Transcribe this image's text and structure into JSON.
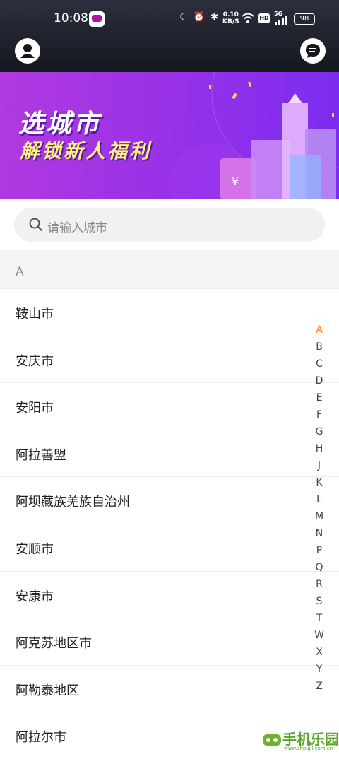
{
  "status_bar": {
    "time": "10:08",
    "speed_value": "0.10",
    "speed_unit": "KB/S",
    "hd": "HD",
    "network": "5G",
    "battery": "98"
  },
  "banner": {
    "title": "选城市",
    "subtitle": "解锁新人福利"
  },
  "search": {
    "placeholder": "请输入城市"
  },
  "section": {
    "letter": "A"
  },
  "cities": [
    "鞍山市",
    "安庆市",
    "安阳市",
    "阿拉善盟",
    "阿坝藏族羌族自治州",
    "安顺市",
    "安康市",
    "阿克苏地区市",
    "阿勒泰地区",
    "阿拉尔市"
  ],
  "index_letters": [
    "A",
    "B",
    "C",
    "D",
    "E",
    "F",
    "G",
    "H",
    "J",
    "K",
    "L",
    "M",
    "N",
    "P",
    "Q",
    "R",
    "S",
    "T",
    "W",
    "X",
    "Y",
    "Z"
  ],
  "active_index": "A",
  "watermark": {
    "text": "手机乐园",
    "url_text": "www.shoujil.com.cn"
  },
  "colors": {
    "accent": "#ff7a2f",
    "banner_start": "#b23ae0",
    "banner_end": "#7a2cf0",
    "topbar": "#1c1e27"
  }
}
